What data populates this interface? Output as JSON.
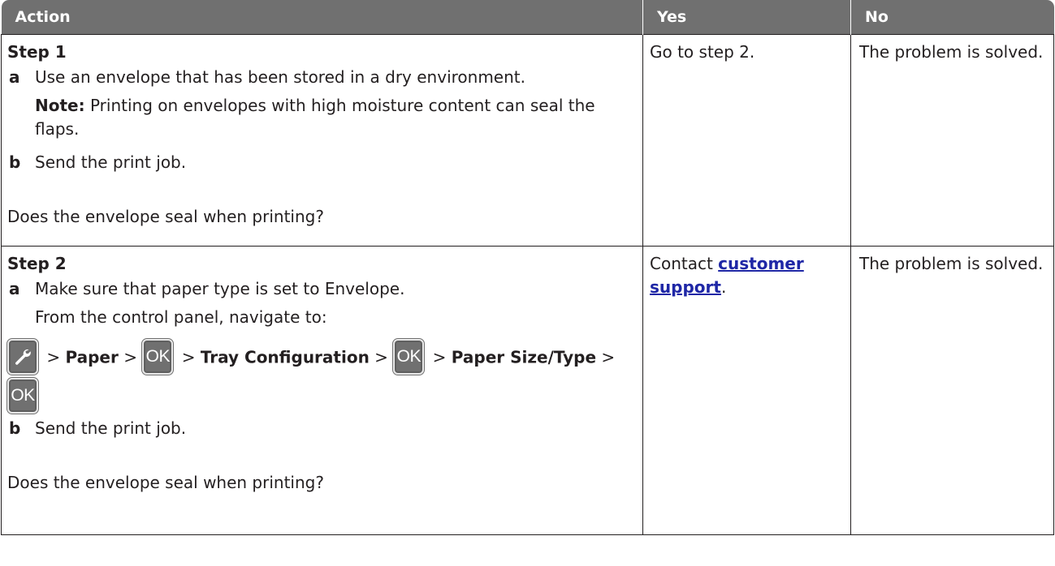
{
  "headers": {
    "action": "Action",
    "yes": "Yes",
    "no": "No"
  },
  "step1": {
    "title": "Step 1",
    "a_letter": "a",
    "a_text": "Use an envelope that has been stored in a dry environment.",
    "note_label": "Note:",
    "note_text": " Printing on envelopes with high moisture content can seal the flaps.",
    "b_letter": "b",
    "b_text": "Send the print job.",
    "question": "Does the envelope seal when printing?",
    "yes": "Go to step 2.",
    "no": "The problem is solved."
  },
  "step2": {
    "title": "Step 2",
    "a_letter": "a",
    "a_text": "Make sure that paper type is set to Envelope.",
    "a_text2": "From the control panel, navigate to:",
    "nav": {
      "sep1": " > ",
      "paper": "Paper",
      "sep2": " > ",
      "ok1": "OK",
      "sep3": " > ",
      "tray": "Tray Configuration",
      "sep4": " > ",
      "ok2": "OK",
      "sep5": " > ",
      "paper_size_type": "Paper Size/Type",
      "sep6": " > ",
      "ok3": "OK",
      "wrench_icon": "wrench-icon"
    },
    "b_letter": "b",
    "b_text": "Send the print job.",
    "question": "Does the envelope seal when printing?",
    "yes_prefix": "Contact ",
    "yes_link": "customer support",
    "yes_suffix": ".",
    "no": "The problem is solved."
  },
  "colors": {
    "header_bg": "#707070",
    "link": "#1f27a6",
    "text": "#231f20"
  }
}
